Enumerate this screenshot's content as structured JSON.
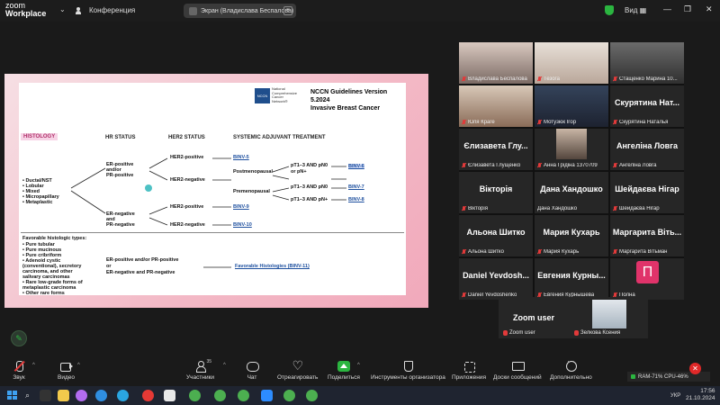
{
  "topbar": {
    "logo_line1": "zoom",
    "logo_line2": "Workplace",
    "dropdown": "⌄",
    "conference_label": "Конференция",
    "share_label": "Экран (Владислава Беспалова)",
    "close": "×",
    "view_label": "Вид",
    "minimize": "—",
    "restore": "❐",
    "window_close": "✕"
  },
  "slide": {
    "nccn_logo": "NCCN",
    "nccn_small": "National Comprehensive Cancer Network®",
    "title_line1": "NCCN Guidelines Version 5.2024",
    "title_line2": "Invasive Breast Cancer",
    "col_histology": "HISTOLOGY",
    "col_hr": "HR STATUS",
    "col_her2": "HER2 STATUS",
    "col_treatment": "SYSTEMIC ADJUVANT TREATMENT",
    "histology_types": [
      "• Ductal/NST",
      "• Lobular",
      "• Mixed",
      "• Micropapillary",
      "• Metaplastic"
    ],
    "hr_pos_1": "ER-positive",
    "hr_pos_2": "and/or",
    "hr_pos_3": "PR-positive",
    "hr_neg_1": "ER-negative",
    "hr_neg_2": "and",
    "hr_neg_3": "PR-negative",
    "her2_pos_a": "HER2-positive",
    "her2_neg_a": "HER2-negative",
    "her2_pos_b": "HER2-positive",
    "her2_neg_b": "HER2-negative",
    "postmeno_1": "Postmenopausal",
    "postmeno_2": "or pN+",
    "premeno": "Premenopausal",
    "pt_a": "pT1–3 AND pN0",
    "pt_b": "pT1–3 AND pN+",
    "pt_c": "pT1–3 AND pN0",
    "pt_d": "pT1–3 AND pN+",
    "link_binv5": "BINV-5",
    "link_binv6": "BINV-6",
    "link_binv7": "BINV-7",
    "link_binv8": "BINV-8",
    "link_binv9": "BINV-9",
    "link_binv10": "BINV-10",
    "favorable_header": "Favorable histologic types:",
    "favorable_types": [
      "• Pure tubular",
      "• Pure mucinous",
      "• Pure cribriform",
      "• Adenoid cystic",
      "  (conventional), secretory",
      "  carcinoma, and other",
      "  salivary carcinomas",
      "• Rare low-grade forms of",
      "  metaplastic carcinoma",
      "• Other rare forms"
    ],
    "fav_hr_1": "ER-positive and/or PR-positive",
    "fav_hr_2": "or",
    "fav_hr_3": "ER-negative and PR-negative",
    "link_favorable": "Favorable Histologies (BINV-11)"
  },
  "participants": [
    {
      "name": "Владислава Беспалова",
      "big": ""
    },
    {
      "name": "Тезога",
      "big": ""
    },
    {
      "name": "Стащенко Марина 10...",
      "big": ""
    },
    {
      "name": "Юля Краге",
      "big": ""
    },
    {
      "name": "Мотузюк Ігор",
      "big": ""
    },
    {
      "name": "Скурятина Наталья",
      "big": "Скурятина Нат..."
    },
    {
      "name": "Єлизавета Глущенко",
      "big": "Єлизавета Глу..."
    },
    {
      "name": "Анна Грідіна 1370709",
      "big": ""
    },
    {
      "name": "Ангеліна Ловга",
      "big": "Ангеліна Ловга"
    },
    {
      "name": "Вікторія",
      "big": "Вікторія"
    },
    {
      "name": "Дана Хандошко",
      "big": "Дана Хандошко"
    },
    {
      "name": "Шейдаєва Нігар",
      "big": "Шейдаєва Нігар"
    },
    {
      "name": "Альона Шитко",
      "big": "Альона Шитко"
    },
    {
      "name": "Мария Кухарь",
      "big": "Мария Кухарь"
    },
    {
      "name": "Маргарита Вітьман",
      "big": "Маргарита Віть..."
    },
    {
      "name": "Daniel Yevdoshenko",
      "big": "Daniel Yevdosh..."
    },
    {
      "name": "Евгения Курнышева",
      "big": "Евгения Курны..."
    },
    {
      "name": "Полна",
      "big": ""
    }
  ],
  "avatar_letter": "П",
  "zoom_user": {
    "big": "Zoom user",
    "name": "Zoom user",
    "other": "Зелкова Ксения"
  },
  "toolbar": {
    "mute": "Звук",
    "video": "Видео",
    "participants": "Участники",
    "participants_count": "35",
    "chat": "Чат",
    "react": "Отреагировать",
    "share": "Поделиться",
    "host_tools": "Инструменты организатора",
    "apps": "Приложения",
    "whiteboards": "Доски сообщений",
    "more": "Дополнительно",
    "ram_cpu": "RAM-71% CPU-46%",
    "end": "✕"
  },
  "taskbar": {
    "time": "17:56",
    "date": "21.10.2024",
    "lang": "УКР"
  },
  "colors": {
    "zoom_green": "#2bb540",
    "end_red": "#e02828",
    "link_blue": "#1d4f9e",
    "avatar_pink": "#e0336a"
  }
}
